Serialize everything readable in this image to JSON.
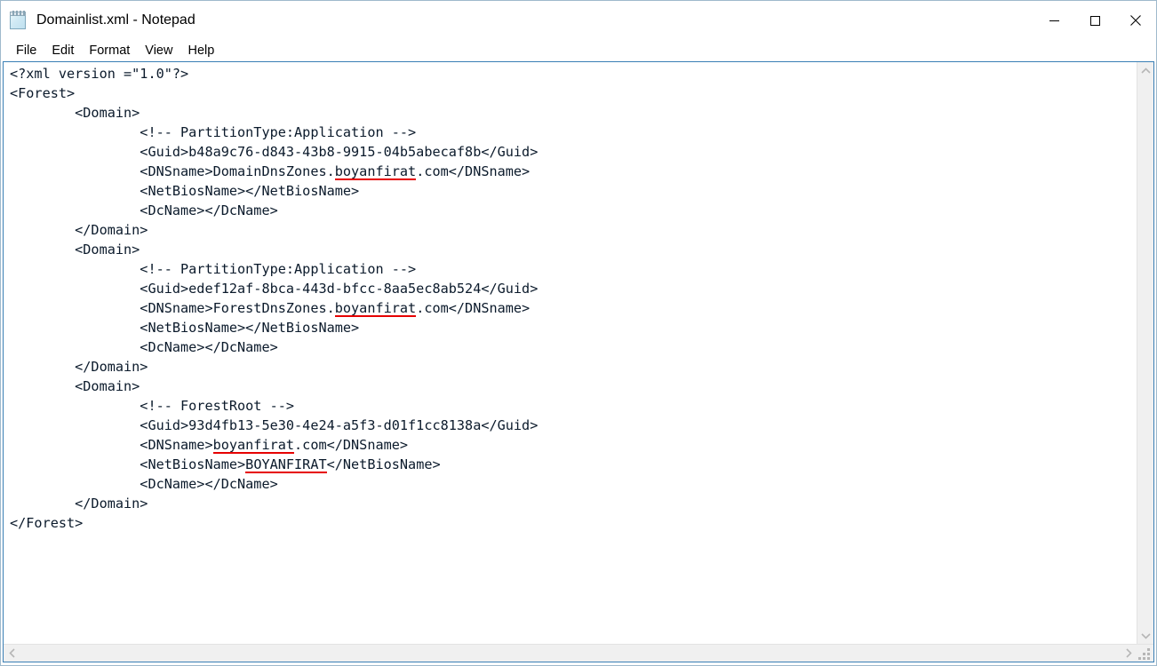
{
  "window": {
    "title": "Domainlist.xml - Notepad",
    "app_icon": "notepad-icon",
    "controls": {
      "minimize": "minimize-button",
      "maximize": "maximize-button",
      "close": "close-button"
    }
  },
  "menubar": {
    "items": [
      {
        "label": "File"
      },
      {
        "label": "Edit"
      },
      {
        "label": "Format"
      },
      {
        "label": "View"
      },
      {
        "label": "Help"
      }
    ]
  },
  "editor": {
    "lines": [
      {
        "text": "<?xml version =\"1.0\"?>"
      },
      {
        "text": "<Forest>"
      },
      {
        "text": "        <Domain>"
      },
      {
        "text": "                <!-- PartitionType:Application -->"
      },
      {
        "text": "                <Guid>b48a9c76-d843-43b8-9915-04b5abecaf8b</Guid>"
      },
      {
        "pre": "                <DNSname>DomainDnsZones.",
        "underlined": "boyanfirat",
        "post": ".com</DNSname>"
      },
      {
        "text": "                <NetBiosName></NetBiosName>"
      },
      {
        "text": "                <DcName></DcName>"
      },
      {
        "text": "        </Domain>"
      },
      {
        "text": "        <Domain>"
      },
      {
        "text": "                <!-- PartitionType:Application -->"
      },
      {
        "text": "                <Guid>edef12af-8bca-443d-bfcc-8aa5ec8ab524</Guid>"
      },
      {
        "pre": "                <DNSname>ForestDnsZones.",
        "underlined": "boyanfirat",
        "post": ".com</DNSname>"
      },
      {
        "text": "                <NetBiosName></NetBiosName>"
      },
      {
        "text": "                <DcName></DcName>"
      },
      {
        "text": "        </Domain>"
      },
      {
        "text": "        <Domain>"
      },
      {
        "text": "                <!-- ForestRoot -->"
      },
      {
        "text": "                <Guid>93d4fb13-5e30-4e24-a5f3-d01f1cc8138a</Guid>"
      },
      {
        "pre": "                <DNSname>",
        "underlined": "boyanfirat",
        "post": ".com</DNSname>"
      },
      {
        "pre": "                <NetBiosName>",
        "underlined": "BOYANFIRAT",
        "post": "</NetBiosName>"
      },
      {
        "text": "                <DcName></DcName>"
      },
      {
        "text": "        </Domain>"
      },
      {
        "text": "</Forest>"
      }
    ]
  },
  "scrollbars": {
    "vertical": {
      "up_arrow": "scroll-up-arrow",
      "down_arrow": "scroll-down-arrow"
    },
    "horizontal": {
      "left_arrow": "scroll-left-arrow",
      "right_arrow": "scroll-right-arrow"
    },
    "resize_grip": "resize-grip"
  },
  "colors": {
    "underline": "#e60000",
    "focus_border": "#3a7fb5",
    "text": "#0b1a2b",
    "scrollbar_track": "#f0f0f0",
    "scrollbar_arrow": "#b6b6b6"
  }
}
